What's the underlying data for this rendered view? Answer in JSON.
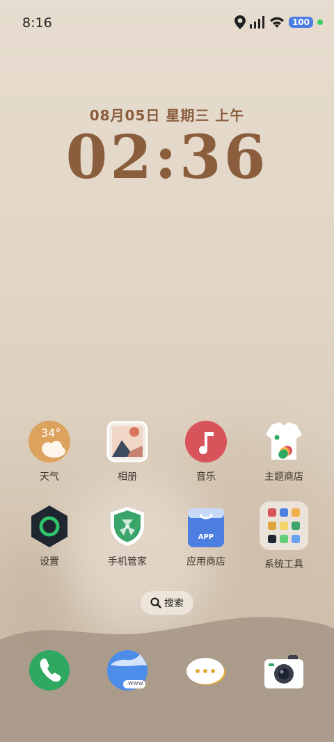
{
  "status_bar": {
    "time": "8:16",
    "battery": "100"
  },
  "lock_clock": {
    "date": "08月05日 星期三 上午",
    "time": "02:36"
  },
  "apps_row1": [
    {
      "label": "天气",
      "badge": "34°",
      "icon": "weather-icon"
    },
    {
      "label": "相册",
      "icon": "gallery-icon"
    },
    {
      "label": "音乐",
      "icon": "music-icon"
    },
    {
      "label": "主题商店",
      "icon": "theme-store-icon"
    }
  ],
  "apps_row2": [
    {
      "label": "设置",
      "icon": "settings-icon"
    },
    {
      "label": "手机管家",
      "icon": "phone-manager-icon"
    },
    {
      "label": "应用商店",
      "badge": "APP",
      "icon": "app-store-icon"
    },
    {
      "label": "系统工具",
      "icon": "system-tools-folder-icon"
    }
  ],
  "search": {
    "label": "搜索"
  },
  "dock": [
    {
      "icon": "phone-icon"
    },
    {
      "icon": "browser-icon",
      "badge": ".www"
    },
    {
      "icon": "messages-icon"
    },
    {
      "icon": "camera-icon"
    }
  ],
  "colors": {
    "accent": "#8a5d3d",
    "music": "#d9535a",
    "store": "#4d7fe0",
    "phone": "#2fa862"
  }
}
